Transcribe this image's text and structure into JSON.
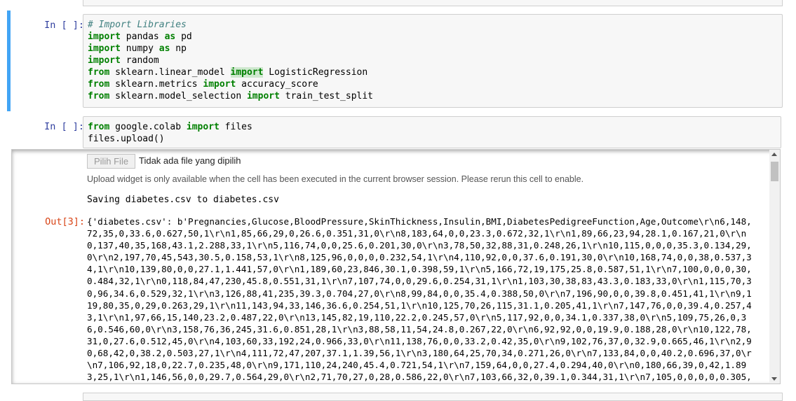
{
  "cell1": {
    "prompt": "In [ ]:",
    "code": [
      [
        {
          "t": "# Import Libraries",
          "c": "cm"
        }
      ],
      [
        {
          "t": "import",
          "c": "kw"
        },
        {
          "t": " pandas "
        },
        {
          "t": "as",
          "c": "kw"
        },
        {
          "t": " pd"
        }
      ],
      [
        {
          "t": "import",
          "c": "kw"
        },
        {
          "t": " numpy "
        },
        {
          "t": "as",
          "c": "kw"
        },
        {
          "t": " np"
        }
      ],
      [
        {
          "t": "import",
          "c": "kw"
        },
        {
          "t": " random"
        }
      ],
      [
        {
          "t": "from",
          "c": "kw"
        },
        {
          "t": " sklearn.linear_model "
        },
        {
          "t": "import",
          "c": "kw hl"
        },
        {
          "t": " LogisticRegression"
        }
      ],
      [
        {
          "t": "from",
          "c": "kw"
        },
        {
          "t": " sklearn.metrics "
        },
        {
          "t": "import",
          "c": "kw"
        },
        {
          "t": " accuracy_score"
        }
      ],
      [
        {
          "t": "from",
          "c": "kw"
        },
        {
          "t": " sklearn.model_selection "
        },
        {
          "t": "import",
          "c": "kw"
        },
        {
          "t": " train_test_split"
        }
      ]
    ]
  },
  "cell2": {
    "prompt": "In [ ]:",
    "code": [
      [
        {
          "t": "from",
          "c": "kw"
        },
        {
          "t": " google.colab "
        },
        {
          "t": "import",
          "c": "kw"
        },
        {
          "t": " files"
        }
      ],
      [
        {
          "t": "files.upload()"
        }
      ]
    ],
    "output": {
      "file_button": "Pilih File",
      "no_file": "Tidak ada file yang dipilih",
      "upload_message": "Upload widget is only available when the cell has been executed in the current browser session. Please rerun this cell to enable.",
      "saving": "Saving diabetes.csv to diabetes.csv",
      "out_prompt": "Out[3]:",
      "out_lines": [
        "{'diabetes.csv': b'Pregnancies,Glucose,BloodPressure,SkinThickness,Insulin,BMI,DiabetesPedigreeFunction,Age,Outcome\\r\\n6,148,",
        "72,35,0,33.6,0.627,50,1\\r\\n1,85,66,29,0,26.6,0.351,31,0\\r\\n8,183,64,0,0,23.3,0.672,32,1\\r\\n1,89,66,23,94,28.1,0.167,21,0\\r\\n",
        "0,137,40,35,168,43.1,2.288,33,1\\r\\n5,116,74,0,0,25.6,0.201,30,0\\r\\n3,78,50,32,88,31,0.248,26,1\\r\\n10,115,0,0,0,35.3,0.134,29,",
        "0\\r\\n2,197,70,45,543,30.5,0.158,53,1\\r\\n8,125,96,0,0,0,0.232,54,1\\r\\n4,110,92,0,0,37.6,0.191,30,0\\r\\n10,168,74,0,0,38,0.537,3",
        "4,1\\r\\n10,139,80,0,0,27.1,1.441,57,0\\r\\n1,189,60,23,846,30.1,0.398,59,1\\r\\n5,166,72,19,175,25.8,0.587,51,1\\r\\n7,100,0,0,0,30,",
        "0.484,32,1\\r\\n0,118,84,47,230,45.8,0.551,31,1\\r\\n7,107,74,0,0,29.6,0.254,31,1\\r\\n1,103,30,38,83,43.3,0.183,33,0\\r\\n1,115,70,3",
        "0,96,34.6,0.529,32,1\\r\\n3,126,88,41,235,39.3,0.704,27,0\\r\\n8,99,84,0,0,35.4,0.388,50,0\\r\\n7,196,90,0,0,39.8,0.451,41,1\\r\\n9,1",
        "19,80,35,0,29,0.263,29,1\\r\\n11,143,94,33,146,36.6,0.254,51,1\\r\\n10,125,70,26,115,31.1,0.205,41,1\\r\\n7,147,76,0,0,39.4,0.257,4",
        "3,1\\r\\n1,97,66,15,140,23.2,0.487,22,0\\r\\n13,145,82,19,110,22.2,0.245,57,0\\r\\n5,117,92,0,0,34.1,0.337,38,0\\r\\n5,109,75,26,0,3",
        "6,0.546,60,0\\r\\n3,158,76,36,245,31.6,0.851,28,1\\r\\n3,88,58,11,54,24.8,0.267,22,0\\r\\n6,92,92,0,0,19.9,0.188,28,0\\r\\n10,122,78,",
        "31,0,27.6,0.512,45,0\\r\\n4,103,60,33,192,24,0.966,33,0\\r\\n11,138,76,0,0,33.2,0.42,35,0\\r\\n9,102,76,37,0,32.9,0.665,46,1\\r\\n2,9",
        "0,68,42,0,38.2,0.503,27,1\\r\\n4,111,72,47,207,37.1,1.39,56,1\\r\\n3,180,64,25,70,34,0.271,26,0\\r\\n7,133,84,0,0,40.2,0.696,37,0\\r",
        "\\n7,106,92,18,0,22.7,0.235,48,0\\r\\n9,171,110,24,240,45.4,0.721,54,1\\r\\n7,159,64,0,0,27.4,0.294,40,0\\r\\n0,180,66,39,0,42,1.89",
        "3,25,1\\r\\n1,146,56,0,0,29.7,0.564,29,0\\r\\n2,71,70,27,0,28,0.586,22,0\\r\\n7,103,66,32,0,39.1,0.344,31,1\\r\\n7,105,0,0,0,0,0.305,"
      ]
    }
  },
  "colors": {
    "selected_border": "#42a5f5",
    "keyword": "#008000",
    "comment": "#408080",
    "in_prompt": "#303f9f",
    "out_prompt": "#d84315"
  }
}
